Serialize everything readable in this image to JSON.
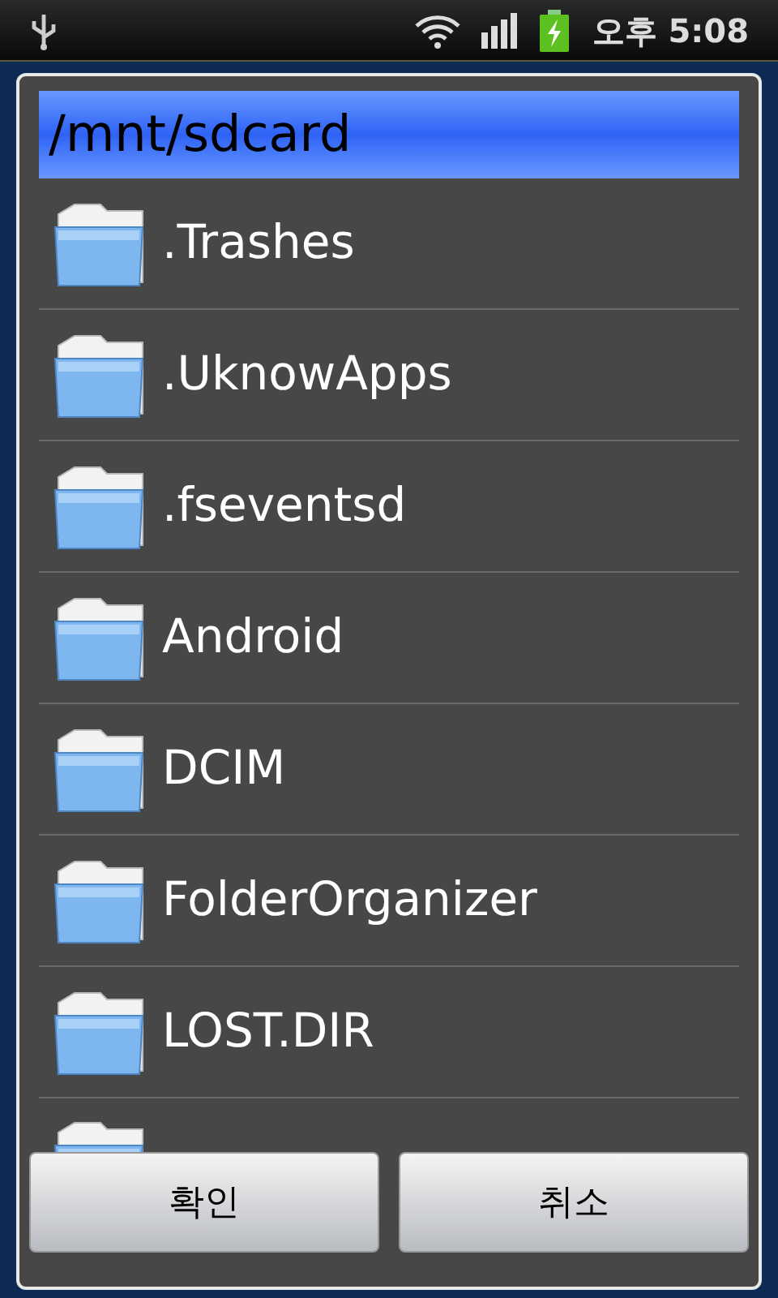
{
  "status_bar": {
    "time": "오후 5:08"
  },
  "dialog": {
    "path": "/mnt/sdcard",
    "folders": [
      {
        "name": ".Trashes"
      },
      {
        "name": ".UknowApps"
      },
      {
        "name": ".fseventsd"
      },
      {
        "name": "Android"
      },
      {
        "name": "DCIM"
      },
      {
        "name": "FolderOrganizer"
      },
      {
        "name": "LOST.DIR"
      }
    ],
    "more_below": true,
    "buttons": [
      {
        "label": "확인"
      },
      {
        "label": "취소"
      }
    ]
  }
}
